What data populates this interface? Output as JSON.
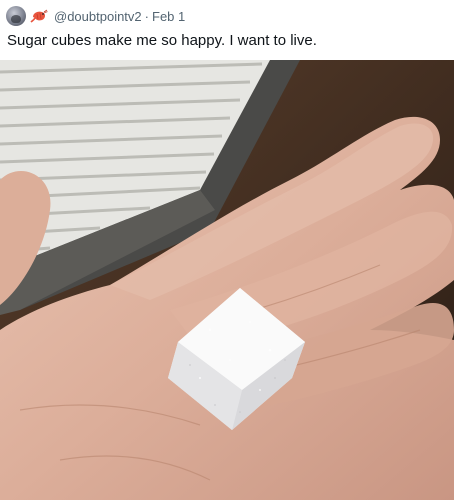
{
  "tweet": {
    "avatar_icon": "profile-avatar",
    "badge_icon": "shrimp-emoji-icon",
    "handle": "@doubtpointv2",
    "separator": "·",
    "date": "Feb 1",
    "text": "Sugar cubes make me so happy. I want to live."
  },
  "media": {
    "kind": "photo"
  }
}
